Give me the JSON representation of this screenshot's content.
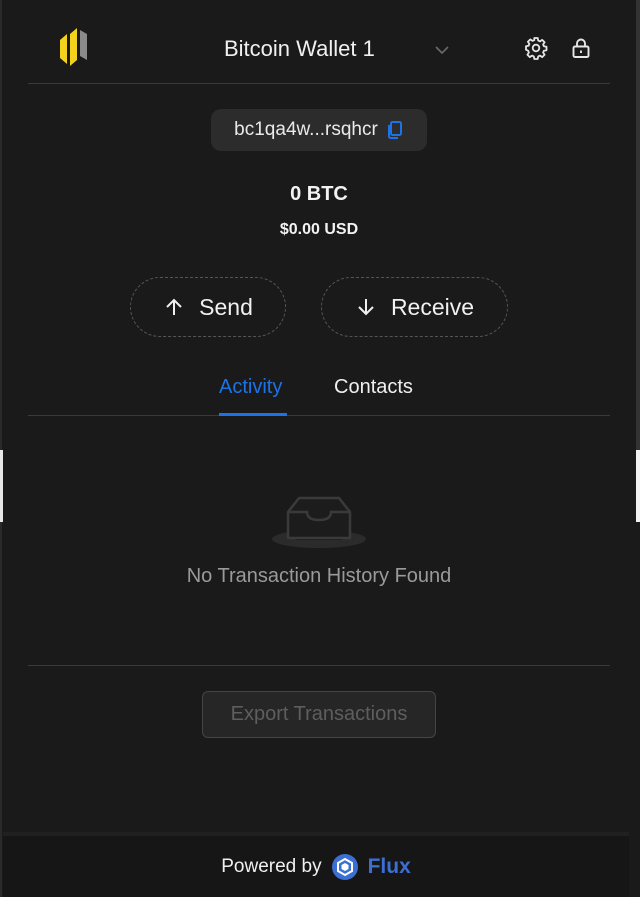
{
  "header": {
    "wallet_name": "Bitcoin Wallet 1"
  },
  "address": {
    "short": "bc1qa4w...rsqhcr"
  },
  "balance": {
    "crypto": "0 BTC",
    "fiat": "$0.00 USD"
  },
  "actions": {
    "send_label": "Send",
    "receive_label": "Receive"
  },
  "tabs": [
    {
      "label": "Activity",
      "active": true
    },
    {
      "label": "Contacts",
      "active": false
    }
  ],
  "activity": {
    "empty_message": "No Transaction History Found"
  },
  "export": {
    "label": "Export Transactions"
  },
  "footer": {
    "powered_by": "Powered by",
    "brand": "Flux"
  },
  "colors": {
    "accent": "#1c73e8",
    "background": "#1a1a1a",
    "logo_yellow": "#f2d21b",
    "flux_blue": "#3c6fd4"
  },
  "icons": [
    "wallet-logo-icon",
    "chevron-down-icon",
    "gear-icon",
    "lock-icon",
    "copy-icon",
    "arrow-up-icon",
    "arrow-down-icon",
    "empty-inbox-icon",
    "flux-logo-icon"
  ]
}
